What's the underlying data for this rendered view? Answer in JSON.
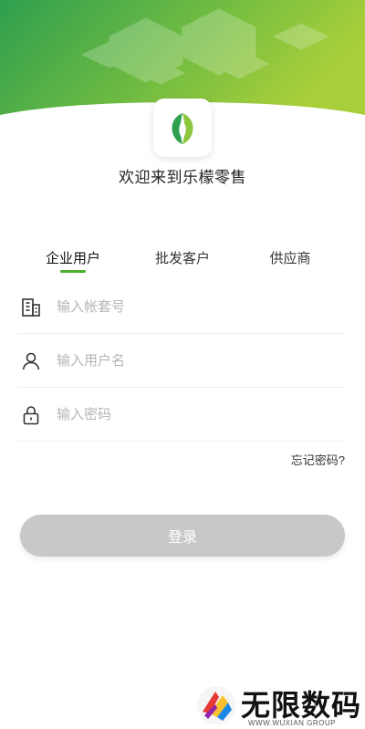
{
  "brand": {
    "welcome": "欢迎来到乐檬零售",
    "accent_color": "#4caf2c",
    "header_gradient": [
      "#2e9f4e",
      "#a8cf3a"
    ],
    "logo_icon": "leaf-logo-icon"
  },
  "tabs": [
    {
      "label": "企业用户",
      "active": true
    },
    {
      "label": "批发客户",
      "active": false
    },
    {
      "label": "供应商",
      "active": false
    }
  ],
  "fields": {
    "account": {
      "placeholder": "输入帐套号",
      "value": "",
      "icon": "building-icon"
    },
    "username": {
      "placeholder": "输入用户名",
      "value": "",
      "icon": "user-icon"
    },
    "password": {
      "placeholder": "输入密码",
      "value": "",
      "icon": "lock-icon"
    }
  },
  "forgot_password": "忘记密码?",
  "login_button": "登录",
  "watermark": {
    "title": "无限数码",
    "subtitle": "WWW.WUXIAN GROUP"
  }
}
